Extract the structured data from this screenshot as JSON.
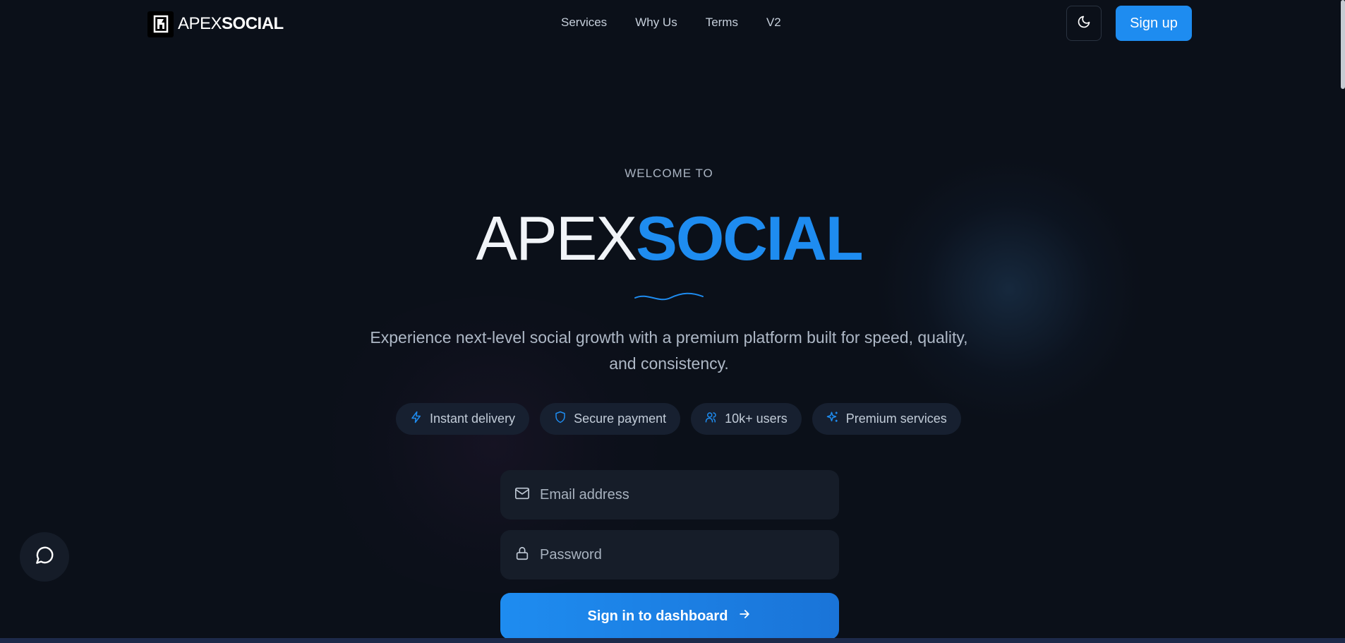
{
  "header": {
    "logo_light": "APEX",
    "logo_bold": "SOCIAL",
    "nav": [
      {
        "label": "Services"
      },
      {
        "label": "Why Us"
      },
      {
        "label": "Terms"
      },
      {
        "label": "V2"
      }
    ],
    "theme_icon": "moon-icon",
    "signup_label": "Sign up"
  },
  "hero": {
    "eyebrow": "WELCOME TO",
    "title_light": "APEX",
    "title_bold": "SOCIAL",
    "subtitle_line1": "Experience next-level social growth with a premium platform built for speed, quality,",
    "subtitle_line2": "and consistency.",
    "features": [
      {
        "icon": "lightning-icon",
        "label": "Instant delivery"
      },
      {
        "icon": "shield-icon",
        "label": "Secure payment"
      },
      {
        "icon": "users-icon",
        "label": "10k+ users"
      },
      {
        "icon": "sparkles-icon",
        "label": "Premium services"
      }
    ]
  },
  "form": {
    "email_placeholder": "Email address",
    "email_value": "",
    "password_placeholder": "Password",
    "password_value": "",
    "submit_label": "Sign in to dashboard"
  },
  "chat": {
    "icon": "chat-bubble-icon"
  },
  "colors": {
    "background": "#0b1019",
    "accent": "#1e8cf0",
    "surface": "#161d29",
    "chip": "#172030"
  }
}
